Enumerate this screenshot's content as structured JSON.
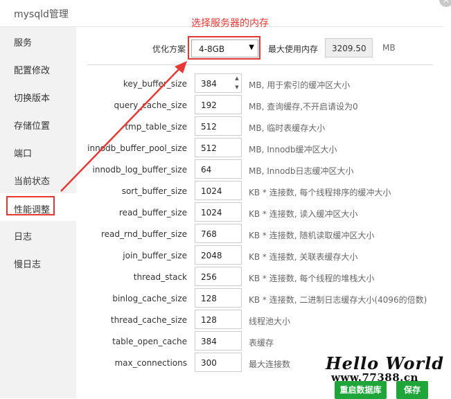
{
  "window": {
    "title": "mysqld管理",
    "close_glyph": "×"
  },
  "sidebar": {
    "items": [
      {
        "label": "服务"
      },
      {
        "label": "配置修改"
      },
      {
        "label": "切换版本"
      },
      {
        "label": "存储位置"
      },
      {
        "label": "端口"
      },
      {
        "label": "当前状态"
      },
      {
        "label": "性能调整",
        "active": true
      },
      {
        "label": "日志"
      },
      {
        "label": "慢日志"
      }
    ]
  },
  "annotation": {
    "text": "选择服务器的内存",
    "color": "#e53935"
  },
  "optimize": {
    "label": "优化方案",
    "selected": "4-8GB",
    "caret": "▼",
    "max_mem_label": "最大使用内存",
    "max_mem_value": "3209.50",
    "max_mem_unit": "MB"
  },
  "params": [
    {
      "name": "key_buffer_size",
      "value": "384",
      "desc": "MB, 用于索引的缓冲区大小"
    },
    {
      "name": "query_cache_size",
      "value": "192",
      "desc": "MB, 查询缓存,不开启请设为0"
    },
    {
      "name": "tmp_table_size",
      "value": "512",
      "desc": "MB, 临时表缓存大小"
    },
    {
      "name": "innodb_buffer_pool_size",
      "value": "512",
      "desc": "MB, Innodb缓冲区大小"
    },
    {
      "name": "innodb_log_buffer_size",
      "value": "64",
      "desc": "MB, Innodb日志缓冲区大小"
    },
    {
      "name": "sort_buffer_size",
      "value": "1024",
      "desc": "KB * 连接数, 每个线程排序的缓冲大小"
    },
    {
      "name": "read_buffer_size",
      "value": "1024",
      "desc": "KB * 连接数, 读入缓冲区大小"
    },
    {
      "name": "read_rnd_buffer_size",
      "value": "768",
      "desc": "KB * 连接数, 随机读取缓冲区大小"
    },
    {
      "name": "join_buffer_size",
      "value": "2048",
      "desc": "KB * 连接数, 关联表缓存大小"
    },
    {
      "name": "thread_stack",
      "value": "256",
      "desc": "KB * 连接数, 每个线程的堆栈大小"
    },
    {
      "name": "binlog_cache_size",
      "value": "128",
      "desc": "KB * 连接数, 二进制日志缓存大小(4096的倍数)"
    },
    {
      "name": "thread_cache_size",
      "value": "128",
      "desc": "线程池大小"
    },
    {
      "name": "table_open_cache",
      "value": "384",
      "desc": "表缓存"
    },
    {
      "name": "max_connections",
      "value": "300",
      "desc": "最大连接数"
    }
  ],
  "spinner": {
    "up": "▲",
    "down": "▼"
  },
  "buttons": {
    "restart": "重启数据库",
    "save": "保存"
  },
  "watermark": {
    "title": "Hello World",
    "url": "www.77388.cn"
  },
  "colors": {
    "accent_green": "#20a53a",
    "annotation_red": "#e53935",
    "sidebar_bg": "#f2f2f2"
  }
}
